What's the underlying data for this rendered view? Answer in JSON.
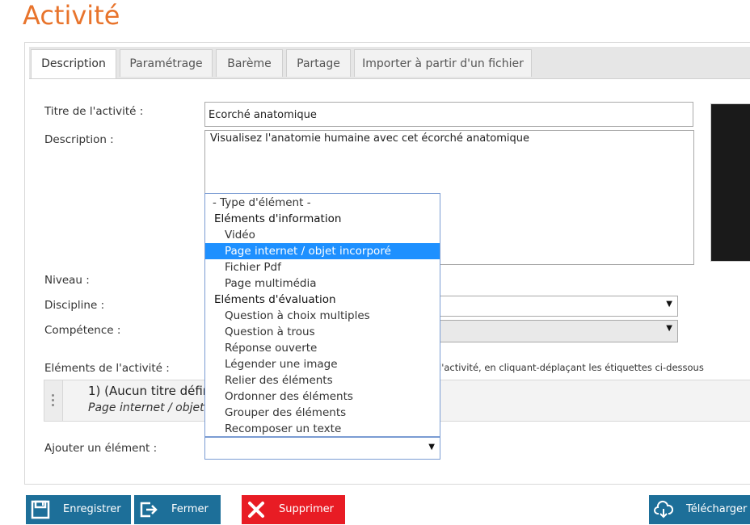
{
  "page": {
    "title": "Activité"
  },
  "tabs": [
    {
      "label": "Description"
    },
    {
      "label": "Paramétrage"
    },
    {
      "label": "Barème"
    },
    {
      "label": "Partage"
    },
    {
      "label": "Importer à partir d'un fichier"
    }
  ],
  "form": {
    "title_label": "Titre de l'activité :",
    "title_value": "Ecorché anatomique",
    "description_label": "Description :",
    "description_value": "Visualisez l'anatomie humaine avec cet écorché anatomique",
    "niveau_label": "Niveau :",
    "discipline_label": "Discipline :",
    "competence_label": "Compétence :",
    "elements_label": "Eléments de l'activité :",
    "elements_hint": "l'activité, en cliquant-déplaçant les étiquettes ci-dessous",
    "add_element_label": "Ajouter un élément :"
  },
  "element_item": {
    "title": "1) (Aucun titre défin",
    "type": "Page internet / objet"
  },
  "dropdown": {
    "options": [
      {
        "label": "- Type d'élément -",
        "kind": "placeholder"
      },
      {
        "label": "Eléments d'information",
        "kind": "group"
      },
      {
        "label": "Vidéo",
        "kind": "option"
      },
      {
        "label": "Page internet / objet incorporé",
        "kind": "selected"
      },
      {
        "label": "Fichier Pdf",
        "kind": "option"
      },
      {
        "label": "Page multimédia",
        "kind": "option"
      },
      {
        "label": "Eléments d'évaluation",
        "kind": "group"
      },
      {
        "label": "Question à choix multiples",
        "kind": "option"
      },
      {
        "label": "Question à trous",
        "kind": "option"
      },
      {
        "label": "Réponse ouverte",
        "kind": "option"
      },
      {
        "label": "Légender une image",
        "kind": "option"
      },
      {
        "label": "Relier des éléments",
        "kind": "option"
      },
      {
        "label": "Ordonner des éléments",
        "kind": "option"
      },
      {
        "label": "Grouper des éléments",
        "kind": "option"
      },
      {
        "label": "Recomposer un texte",
        "kind": "option"
      }
    ]
  },
  "buttons": {
    "save": "Enregistrer",
    "close": "Fermer",
    "delete": "Supprimer",
    "download": "Télécharger l"
  },
  "colors": {
    "title": "#e8742c",
    "button_blue": "#1d6f99",
    "button_red": "#e81c24",
    "selected_option": "#1e90ff"
  }
}
